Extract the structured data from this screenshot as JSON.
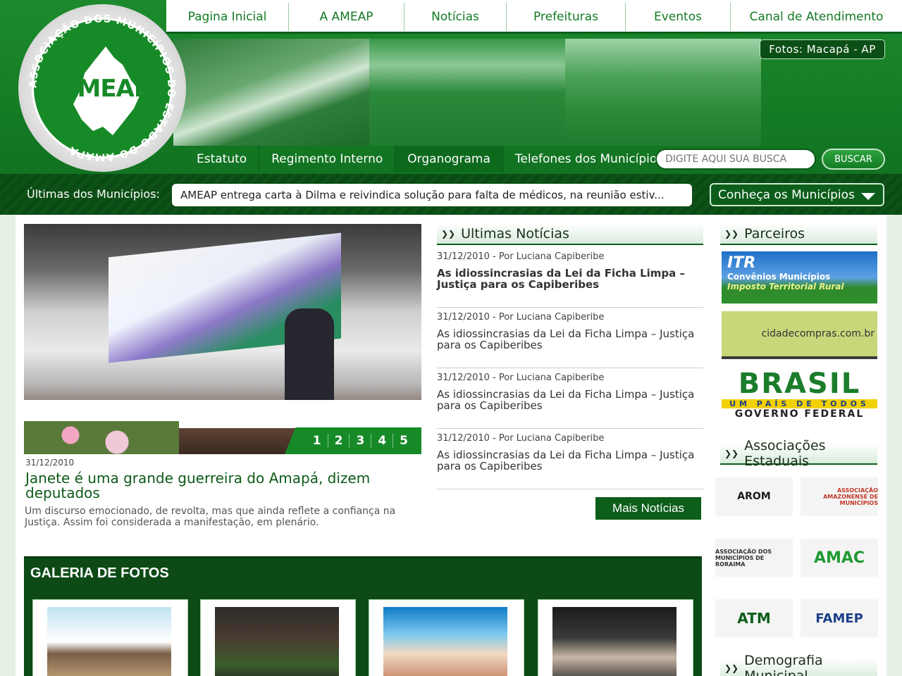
{
  "topnav": [
    "Pagina Inicial",
    "A AMEAP",
    "Notícias",
    "Prefeituras",
    "Eventos",
    "Canal de Atendimento"
  ],
  "logo": {
    "abbr": "AMEAP",
    "ring_text": "ASSOCIAÇÃO DOS MUNICÍPIOS DO ESTADO DO AMAPÁ"
  },
  "photo_caption": "Fotos:  Macapá - AP",
  "subnav": [
    "Estatuto",
    "Regimento Interno",
    "Organograma",
    "Telefones dos Municípios"
  ],
  "search": {
    "placeholder": "DIGITE AQUI SUA BUSCA",
    "button": "BUSCAR"
  },
  "newsbar": {
    "label": "Últimas dos Municípios:",
    "ticker": "AMEAP entrega carta à Dilma e reivindica solução para falta de médicos, na reunião estiv...",
    "select_label": "Conheça os Municípios"
  },
  "feature": {
    "slides": [
      "1",
      "2",
      "3",
      "4",
      "5"
    ],
    "date": "31/12/2010",
    "title": "Janete é uma grande guerreira do Amapá, dizem deputados",
    "summary": "Um discurso emocionado, de revolta, mas que ainda reflete a confiança na Justiça. Assim foi considerada a manifestação, em plenário."
  },
  "news": {
    "heading": "Ultimas Notícias",
    "items": [
      {
        "meta": "31/12/2010 - Por Luciana Capiberibe",
        "title": "As idiossincrasias da Lei da Ficha Limpa – Justiça para os Capiberibes"
      },
      {
        "meta": "31/12/2010 - Por Luciana Capiberibe",
        "title": "As idiossincrasias da Lei da Ficha Limpa – Justiça para os Capiberibes"
      },
      {
        "meta": "31/12/2010 - Por Luciana Capiberibe",
        "title": "As idiossincrasias da Lei da Ficha Limpa – Justiça para os Capiberibes"
      },
      {
        "meta": "31/12/2010 - Por Luciana Capiberibe",
        "title": "As idiossincrasias da Lei da Ficha Limpa – Justiça para os Capiberibes"
      }
    ],
    "more_button": "Mais Notícias"
  },
  "partners": {
    "heading": "Parceiros",
    "itr": {
      "big": "ITR",
      "line1": "Convênios Municípios",
      "line2": "Imposto Territorial Rural"
    },
    "cidade": "cidadecompras.com.br",
    "brasil": {
      "word": "BRASIL",
      "band": "UM PAÍS DE TODOS",
      "gov": "GOVERNO FEDERAL"
    }
  },
  "associations": {
    "heading": "Associações Estaduais",
    "logos": [
      "AROM",
      "ASSOCIAÇÃO AMAZONENSE DE MUNICÍPIOS",
      "ASSOCIAÇÃO DOS MUNICÍPIOS DE RORAIMA",
      "AMAC",
      "ATM",
      "FAMEP"
    ]
  },
  "demografia": {
    "heading": "Demografia Municipal"
  },
  "gallery": {
    "title": "GALERIA DE FOTOS"
  },
  "colors": {
    "brand_green": "#178a28",
    "dark_green": "#0c5e1a"
  }
}
